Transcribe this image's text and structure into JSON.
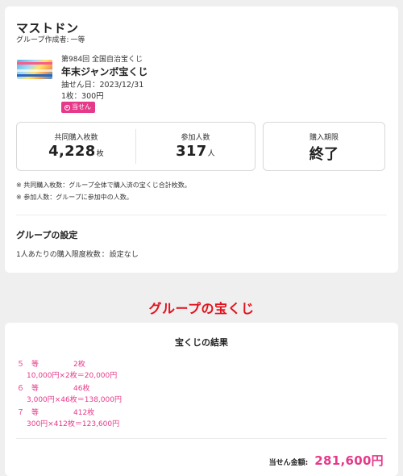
{
  "group": {
    "name": "マストドン",
    "creator_label": "グループ作成者:",
    "creator_name": "一等"
  },
  "lottery": {
    "round": "第984回 全国自治宝くじ",
    "name": "年末ジャンボ宝くじ",
    "draw_date": "抽せん日：2023/12/31",
    "price": "1枚：300円",
    "badge": "当せん"
  },
  "stats": {
    "purchased_label": "共同購入枚数",
    "purchased_value": "4,228",
    "purchased_unit": "枚",
    "members_label": "参加人数",
    "members_value": "317",
    "members_unit": "人",
    "deadline_label": "購入期限",
    "deadline_value": "終了"
  },
  "notes": {
    "note1": "※ 共同購入枚数：グループ全体で購入済の宝くじ合計枚数。",
    "note2": "※ 参加人数：グループに参加中の人数。"
  },
  "settings": {
    "title": "グループの設定",
    "limit_label": "1人あたりの購入限度枚数",
    "limit_value": "設定なし"
  },
  "section_title": "グループの宝くじ",
  "results": {
    "title": "宝くじの結果",
    "prizes": [
      {
        "rank": "５　等",
        "count": "2枚",
        "calc": "10,000円×2枚＝20,000円"
      },
      {
        "rank": "６　等",
        "count": "46枚",
        "calc": "3,000円×46枚＝138,000円"
      },
      {
        "rank": "７　等",
        "count": "412枚",
        "calc": "300円×412枚＝123,600円"
      }
    ],
    "total_label": "当せん金額:",
    "total_value": "281,600円"
  },
  "colors": {
    "accent_pink": "#e6398a",
    "section_red": "#e0111b",
    "background": "#efefef"
  }
}
